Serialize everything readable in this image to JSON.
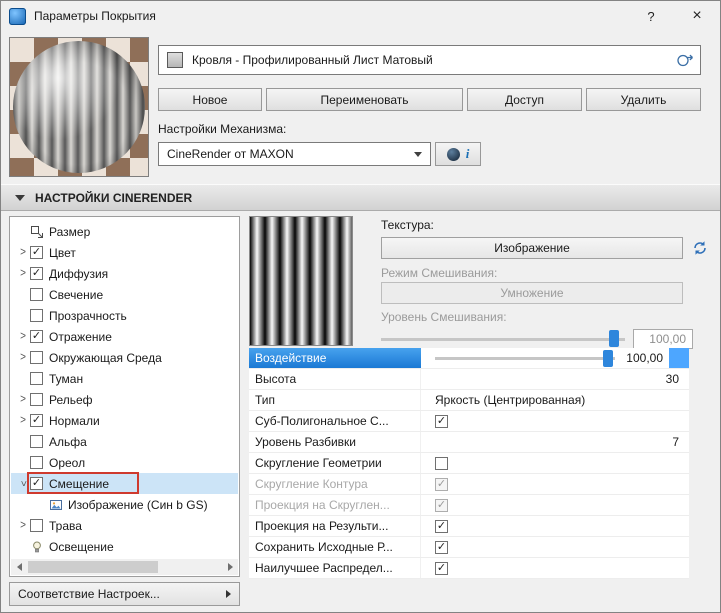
{
  "window": {
    "title": "Параметры Покрытия",
    "help_label": "?",
    "close_label": "×"
  },
  "material_header": {
    "name": "Кровля - Профилированный Лист Матовый",
    "new_button": "Новое",
    "rename_button": "Переименовать",
    "access_button": "Доступ",
    "delete_button": "Удалить",
    "engine_label": "Настройки Механизма:",
    "engine_value": "CineRender от MAXON",
    "engine_info": "i"
  },
  "section": {
    "title": "НАСТРОЙКИ CINERENDER"
  },
  "tree": {
    "items": [
      {
        "label": "Размер",
        "icon": "size-icon"
      },
      {
        "label": "Цвет",
        "check": true,
        "chevron": "right"
      },
      {
        "label": "Диффузия",
        "check": true,
        "chevron": "right"
      },
      {
        "label": "Свечение",
        "check": false
      },
      {
        "label": "Прозрачность",
        "check": false
      },
      {
        "label": "Отражение",
        "check": true,
        "chevron": "right"
      },
      {
        "label": "Окружающая Среда",
        "check": false,
        "chevron": "right"
      },
      {
        "label": "Туман",
        "check": false
      },
      {
        "label": "Рельеф",
        "check": false,
        "chevron": "right"
      },
      {
        "label": "Нормали",
        "check": true,
        "chevron": "right"
      },
      {
        "label": "Альфа",
        "check": false
      },
      {
        "label": "Ореол",
        "check": false
      },
      {
        "label": "Смещение",
        "check": true,
        "chevron": "down",
        "selected": true,
        "outlined": true
      },
      {
        "label": "Изображение (Син b GS)",
        "icon": "image-icon",
        "child": true
      },
      {
        "label": "Трава",
        "check": false,
        "chevron": "right"
      },
      {
        "label": "Освещение",
        "icon": "light-icon"
      }
    ],
    "match_button": "Соответствие Настроек..."
  },
  "texture_panel": {
    "texture_label": "Текстура:",
    "texture_button": "Изображение",
    "blend_mode_label": "Режим Смешивания:",
    "blend_mode_value": "Умножение",
    "blend_level_label": "Уровень Смешивания:",
    "blend_level_value": "100,00"
  },
  "props": {
    "rows": [
      {
        "label": "Воздействие",
        "type": "slider",
        "value": "100,00",
        "selected": true,
        "swatch": "#4da6ff"
      },
      {
        "label": "Высота",
        "type": "number",
        "value": "30"
      },
      {
        "label": "Тип",
        "type": "text",
        "value": "Яркость (Центрированная)"
      },
      {
        "label": "Суб-Полигональное С...",
        "type": "checkbox",
        "checked": true
      },
      {
        "label": "Уровень Разбивки",
        "type": "number",
        "value": "7"
      },
      {
        "label": "Скругление Геометрии",
        "type": "checkbox",
        "checked": false
      },
      {
        "label": "Скругление Контура",
        "type": "checkbox",
        "checked": true,
        "disabled": true
      },
      {
        "label": "Проекция на Скруглен...",
        "type": "checkbox",
        "checked": true,
        "disabled": true
      },
      {
        "label": "Проекция на Результи...",
        "type": "checkbox",
        "checked": true
      },
      {
        "label": "Сохранить Исходные Р...",
        "type": "checkbox",
        "checked": true
      },
      {
        "label": "Наилучшее Распредел...",
        "type": "checkbox",
        "checked": true
      }
    ]
  },
  "colors": {
    "selection_highlight": "#cce4f7",
    "accent_blue": "#2e86dc",
    "annotation_red": "#cf3a2e"
  }
}
